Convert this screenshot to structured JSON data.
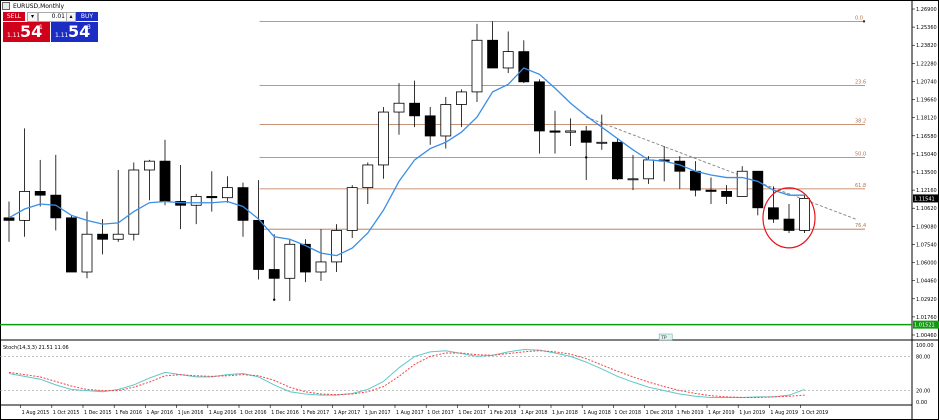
{
  "window": {
    "title": "EURUSD,Monthly"
  },
  "trade_panel": {
    "sell_label": "SELL",
    "buy_label": "BUY",
    "lot_value": "0.01",
    "sell_prefix": "1.11",
    "sell_big": "54",
    "sell_sup": "1",
    "buy_prefix": "1.11",
    "buy_big": "54",
    "buy_sup": "3"
  },
  "colors": {
    "candle_up": "#ffffff",
    "candle_down": "#000000",
    "moving_average": "#3a8ee6",
    "fibonacci": "#b5714a",
    "trendline": "#808080",
    "highlight_circle": "#e8141b",
    "horizontal_line": "#0f9d0f",
    "stoch_main": "#5ec8c8",
    "stoch_signal": "#ff4040"
  },
  "price_axis": {
    "labels": [
      "1.26900",
      "1.25360",
      "1.23820",
      "1.22280",
      "1.20740",
      "1.19660",
      "1.18120",
      "1.16580",
      "1.15040",
      "1.13500",
      "1.12160",
      "1.10620",
      "1.09080",
      "1.07540",
      "1.06000",
      "1.04460",
      "1.02920",
      "1.01760",
      "1.00460"
    ],
    "current_price": "1.11541",
    "green_line_price": "1.01521"
  },
  "fibonacci_levels": [
    {
      "label": "0.0"
    },
    {
      "label": "23.6"
    },
    {
      "label": "38.2"
    },
    {
      "label": "50.0"
    },
    {
      "label": "61.8"
    },
    {
      "label": "76.4"
    }
  ],
  "time_axis": {
    "labels": [
      "1 Aug 2015",
      "1 Oct 2015",
      "1 Dec 2015",
      "1 Feb 2016",
      "1 Apr 2016",
      "1 Jun 2016",
      "1 Aug 2016",
      "1 Oct 2016",
      "1 Dec 2016",
      "1 Feb 2017",
      "1 Apr 2017",
      "1 Jun 2017",
      "1 Aug 2017",
      "1 Oct 2017",
      "1 Dec 2017",
      "1 Feb 2018",
      "1 Apr 2018",
      "1 Jun 2018",
      "1 Aug 2018",
      "1 Oct 2018",
      "1 Dec 2018",
      "1 Feb 2019",
      "1 Apr 2019",
      "1 Jun 2019",
      "1 Aug 2019",
      "1 Oct 2019"
    ]
  },
  "stochastic": {
    "label": "Stoch(14,3,3) 21.51 11.06",
    "axis_labels": [
      "100.00",
      "80.00",
      "20.00",
      "0.00"
    ]
  },
  "period_badge": "TP",
  "chart_data": {
    "type": "candlestick",
    "symbol": "EURUSD",
    "timeframe": "Monthly",
    "candles": [
      {
        "t": "Jul 2015",
        "o": 1.1,
        "h": 1.113,
        "l": 1.081,
        "c": 1.098
      },
      {
        "t": "Aug 2015",
        "o": 1.098,
        "h": 1.171,
        "l": 1.085,
        "c": 1.121
      },
      {
        "t": "Sep 2015",
        "o": 1.121,
        "h": 1.146,
        "l": 1.109,
        "c": 1.118
      },
      {
        "t": "Oct 2015",
        "o": 1.118,
        "h": 1.15,
        "l": 1.09,
        "c": 1.1
      },
      {
        "t": "Nov 2015",
        "o": 1.1,
        "h": 1.102,
        "l": 1.057,
        "c": 1.057
      },
      {
        "t": "Dec 2015",
        "o": 1.057,
        "h": 1.105,
        "l": 1.052,
        "c": 1.087
      },
      {
        "t": "Jan 2016",
        "o": 1.087,
        "h": 1.099,
        "l": 1.071,
        "c": 1.083
      },
      {
        "t": "Feb 2016",
        "o": 1.083,
        "h": 1.138,
        "l": 1.081,
        "c": 1.087
      },
      {
        "t": "Mar 2016",
        "o": 1.087,
        "h": 1.144,
        "l": 1.082,
        "c": 1.138
      },
      {
        "t": "Apr 2016",
        "o": 1.138,
        "h": 1.146,
        "l": 1.114,
        "c": 1.145
      },
      {
        "t": "May 2016",
        "o": 1.145,
        "h": 1.162,
        "l": 1.11,
        "c": 1.113
      },
      {
        "t": "Jun 2016",
        "o": 1.113,
        "h": 1.142,
        "l": 1.091,
        "c": 1.11
      },
      {
        "t": "Jul 2016",
        "o": 1.11,
        "h": 1.119,
        "l": 1.095,
        "c": 1.117
      },
      {
        "t": "Aug 2016",
        "o": 1.117,
        "h": 1.137,
        "l": 1.105,
        "c": 1.116
      },
      {
        "t": "Sep 2016",
        "o": 1.116,
        "h": 1.133,
        "l": 1.112,
        "c": 1.124
      },
      {
        "t": "Oct 2016",
        "o": 1.124,
        "h": 1.128,
        "l": 1.085,
        "c": 1.098
      },
      {
        "t": "Nov 2016",
        "o": 1.098,
        "h": 1.13,
        "l": 1.051,
        "c": 1.059
      },
      {
        "t": "Dec 2016",
        "o": 1.059,
        "h": 1.087,
        "l": 1.035,
        "c": 1.052
      },
      {
        "t": "Jan 2017",
        "o": 1.052,
        "h": 1.083,
        "l": 1.034,
        "c": 1.079
      },
      {
        "t": "Feb 2017",
        "o": 1.079,
        "h": 1.083,
        "l": 1.049,
        "c": 1.057
      },
      {
        "t": "Mar 2017",
        "o": 1.057,
        "h": 1.091,
        "l": 1.05,
        "c": 1.065
      },
      {
        "t": "Apr 2017",
        "o": 1.065,
        "h": 1.095,
        "l": 1.057,
        "c": 1.09
      },
      {
        "t": "May 2017",
        "o": 1.09,
        "h": 1.126,
        "l": 1.084,
        "c": 1.124
      },
      {
        "t": "Jun 2017",
        "o": 1.124,
        "h": 1.144,
        "l": 1.111,
        "c": 1.142
      },
      {
        "t": "Jul 2017",
        "o": 1.142,
        "h": 1.188,
        "l": 1.131,
        "c": 1.184
      },
      {
        "t": "Aug 2017",
        "o": 1.184,
        "h": 1.207,
        "l": 1.166,
        "c": 1.191
      },
      {
        "t": "Sep 2017",
        "o": 1.191,
        "h": 1.209,
        "l": 1.172,
        "c": 1.181
      },
      {
        "t": "Oct 2017",
        "o": 1.181,
        "h": 1.188,
        "l": 1.158,
        "c": 1.165
      },
      {
        "t": "Nov 2017",
        "o": 1.165,
        "h": 1.196,
        "l": 1.155,
        "c": 1.19
      },
      {
        "t": "Dec 2017",
        "o": 1.19,
        "h": 1.202,
        "l": 1.172,
        "c": 1.2
      },
      {
        "t": "Jan 2018",
        "o": 1.2,
        "h": 1.254,
        "l": 1.192,
        "c": 1.241
      },
      {
        "t": "Feb 2018",
        "o": 1.241,
        "h": 1.256,
        "l": 1.22,
        "c": 1.219
      },
      {
        "t": "Mar 2018",
        "o": 1.219,
        "h": 1.248,
        "l": 1.215,
        "c": 1.232
      },
      {
        "t": "Apr 2018",
        "o": 1.232,
        "h": 1.241,
        "l": 1.207,
        "c": 1.208
      },
      {
        "t": "May 2018",
        "o": 1.208,
        "h": 1.21,
        "l": 1.151,
        "c": 1.169
      },
      {
        "t": "Jun 2018",
        "o": 1.169,
        "h": 1.185,
        "l": 1.151,
        "c": 1.168
      },
      {
        "t": "Jul 2018",
        "o": 1.168,
        "h": 1.179,
        "l": 1.157,
        "c": 1.169
      },
      {
        "t": "Aug 2018",
        "o": 1.169,
        "h": 1.173,
        "l": 1.13,
        "c": 1.16
      },
      {
        "t": "Sep 2018",
        "o": 1.16,
        "h": 1.182,
        "l": 1.154,
        "c": 1.16
      },
      {
        "t": "Oct 2018",
        "o": 1.16,
        "h": 1.163,
        "l": 1.13,
        "c": 1.131
      },
      {
        "t": "Nov 2018",
        "o": 1.131,
        "h": 1.15,
        "l": 1.122,
        "c": 1.131
      },
      {
        "t": "Dec 2018",
        "o": 1.131,
        "h": 1.149,
        "l": 1.127,
        "c": 1.146
      },
      {
        "t": "Jan 2019",
        "o": 1.146,
        "h": 1.157,
        "l": 1.129,
        "c": 1.145
      },
      {
        "t": "Feb 2019",
        "o": 1.145,
        "h": 1.149,
        "l": 1.123,
        "c": 1.137
      },
      {
        "t": "Mar 2019",
        "o": 1.137,
        "h": 1.145,
        "l": 1.117,
        "c": 1.122
      },
      {
        "t": "Apr 2019",
        "o": 1.122,
        "h": 1.132,
        "l": 1.111,
        "c": 1.121
      },
      {
        "t": "May 2019",
        "o": 1.121,
        "h": 1.126,
        "l": 1.111,
        "c": 1.117
      },
      {
        "t": "Jun 2019",
        "o": 1.117,
        "h": 1.141,
        "l": 1.118,
        "c": 1.137
      },
      {
        "t": "Jul 2019",
        "o": 1.137,
        "h": 1.129,
        "l": 1.102,
        "c": 1.108
      },
      {
        "t": "Aug 2019",
        "o": 1.108,
        "h": 1.125,
        "l": 1.096,
        "c": 1.099
      },
      {
        "t": "Sep 2019",
        "o": 1.099,
        "h": 1.111,
        "l": 1.088,
        "c": 1.09
      },
      {
        "t": "Oct 2019",
        "o": 1.09,
        "h": 1.118,
        "l": 1.088,
        "c": 1.1154
      }
    ],
    "moving_average": [
      1.1,
      1.107,
      1.111,
      1.11,
      1.102,
      1.098,
      1.095,
      1.096,
      1.105,
      1.112,
      1.113,
      1.112,
      1.112,
      1.112,
      1.113,
      1.109,
      1.099,
      1.085,
      1.083,
      1.078,
      1.072,
      1.07,
      1.076,
      1.088,
      1.106,
      1.129,
      1.146,
      1.155,
      1.16,
      1.168,
      1.18,
      1.2,
      1.206,
      1.219,
      1.214,
      1.203,
      1.191,
      1.181,
      1.172,
      1.163,
      1.154,
      1.146,
      1.145,
      1.142,
      1.137,
      1.134,
      1.132,
      1.132,
      1.129,
      1.122,
      1.118,
      1.118
    ],
    "fibonacci_prices": {
      "0.0": 1.256,
      "23.6": 1.205,
      "38.2": 1.174,
      "50.0": 1.148,
      "61.8": 1.123,
      "76.4": 1.091
    },
    "trendline": [
      {
        "t": "Aug 2018",
        "p": 1.18
      },
      {
        "t": "Dec 2019",
        "p": 1.099
      }
    ],
    "stochastic_main": [
      50,
      45,
      40,
      30,
      22,
      20,
      18,
      22,
      30,
      42,
      52,
      48,
      44,
      44,
      48,
      50,
      44,
      30,
      18,
      14,
      12,
      12,
      15,
      22,
      36,
      60,
      80,
      88,
      90,
      85,
      80,
      82,
      88,
      92,
      91,
      86,
      80,
      70,
      58,
      45,
      35,
      26,
      20,
      14,
      10,
      8,
      8,
      8,
      9,
      9,
      12,
      22
    ],
    "stochastic_signal": [
      52,
      48,
      44,
      36,
      28,
      22,
      20,
      20,
      26,
      35,
      46,
      48,
      46,
      45,
      46,
      48,
      46,
      38,
      26,
      18,
      14,
      13,
      14,
      18,
      27,
      45,
      66,
      80,
      86,
      86,
      83,
      82,
      85,
      88,
      90,
      88,
      84,
      76,
      65,
      54,
      44,
      35,
      27,
      20,
      15,
      11,
      9,
      8,
      8,
      9,
      10,
      12
    ]
  }
}
